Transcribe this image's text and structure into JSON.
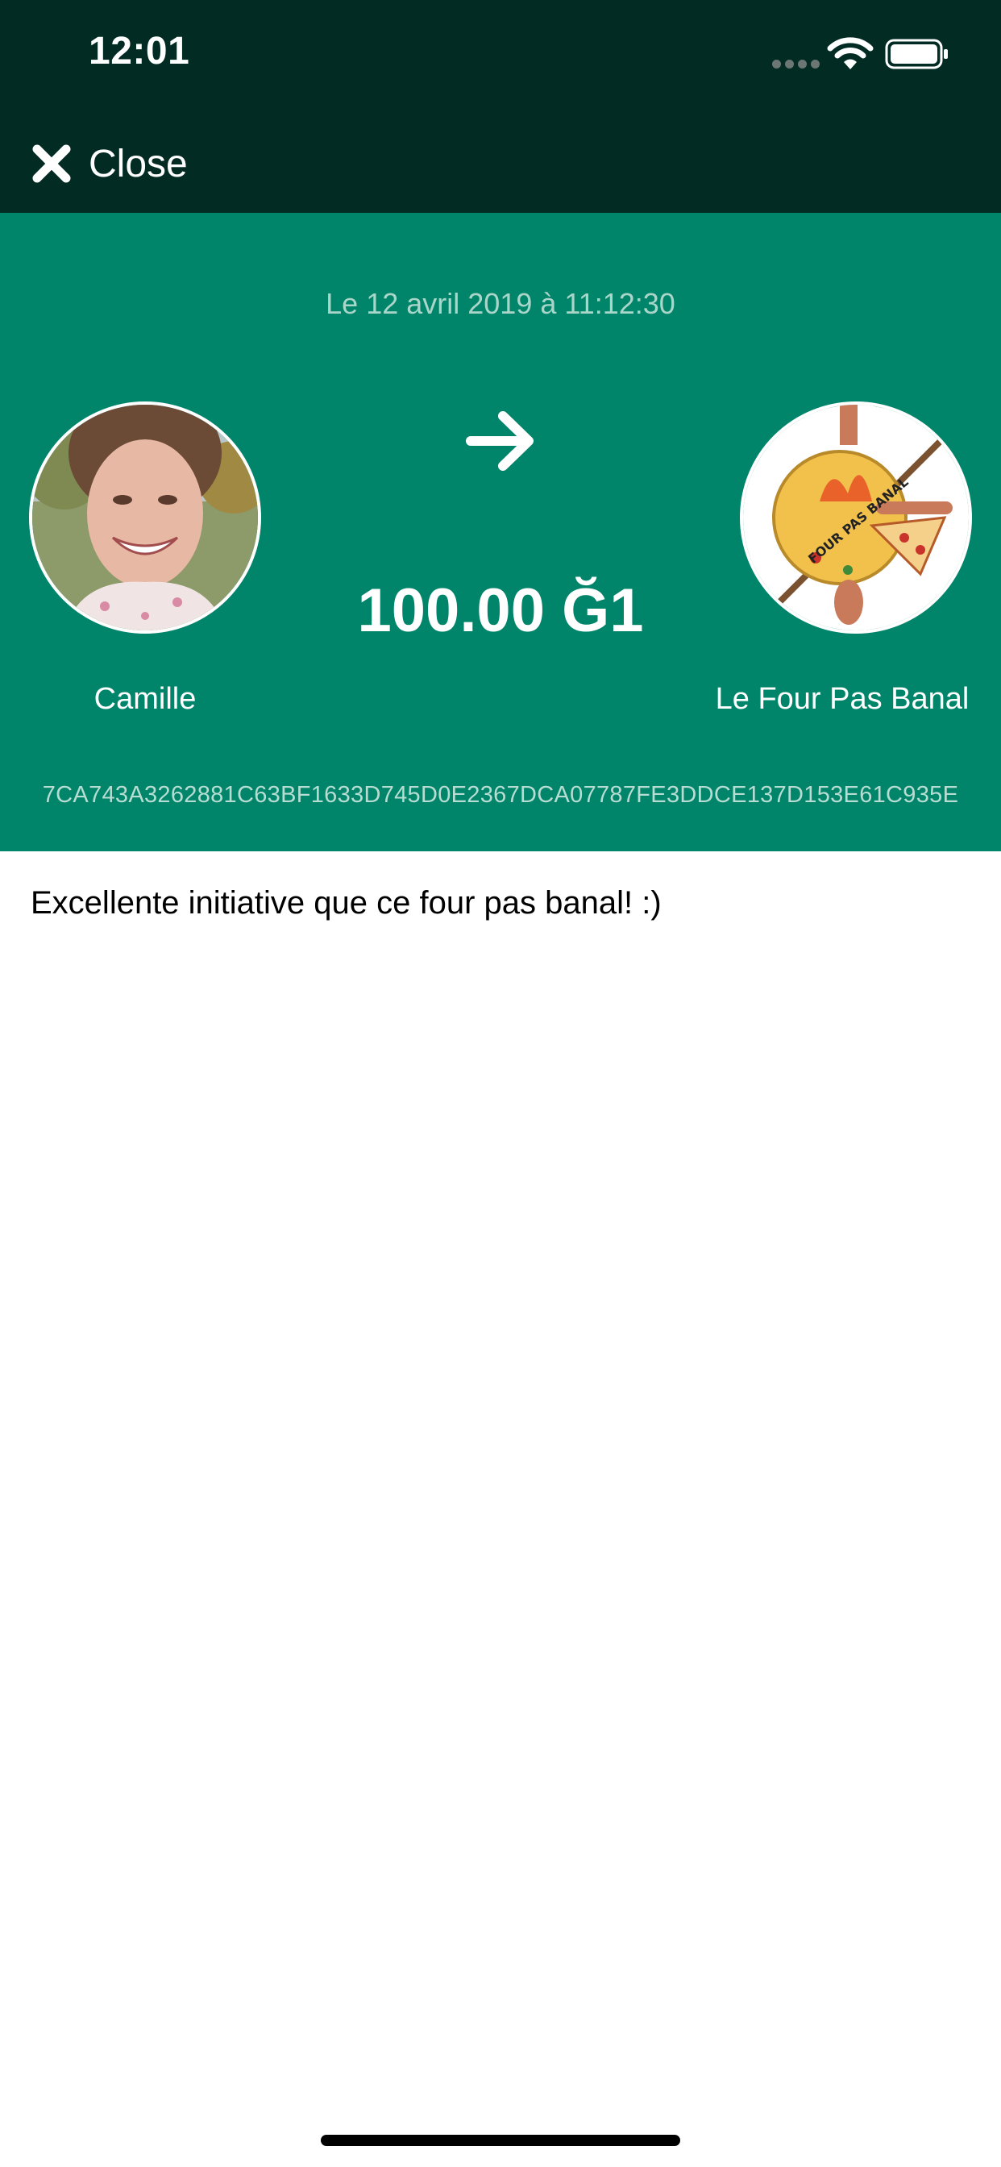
{
  "status_bar": {
    "time": "12:01"
  },
  "nav": {
    "close_label": "Close"
  },
  "transaction": {
    "date": "Le 12 avril 2019 à 11:12:30",
    "amount": "100.00 Ğ1",
    "sender_name": "Camille",
    "receiver_name": "Le Four Pas Banal",
    "receiver_logo_text": "FOUR PAS BANAL",
    "hash": "7CA743A3262881C63BF1633D745D0E2367DCA07787FE3DDCE137D153E61C935E",
    "comment": "Excellente initiative que ce four pas banal! :)"
  },
  "colors": {
    "status_bar_bg": "#012b23",
    "header_bg": "#00846a",
    "text_light": "#ffffff",
    "date_text": "#a9d6c9"
  },
  "icons": {
    "close": "close-icon",
    "arrow": "arrow-right-icon",
    "wifi": "wifi-icon",
    "battery": "battery-icon"
  }
}
